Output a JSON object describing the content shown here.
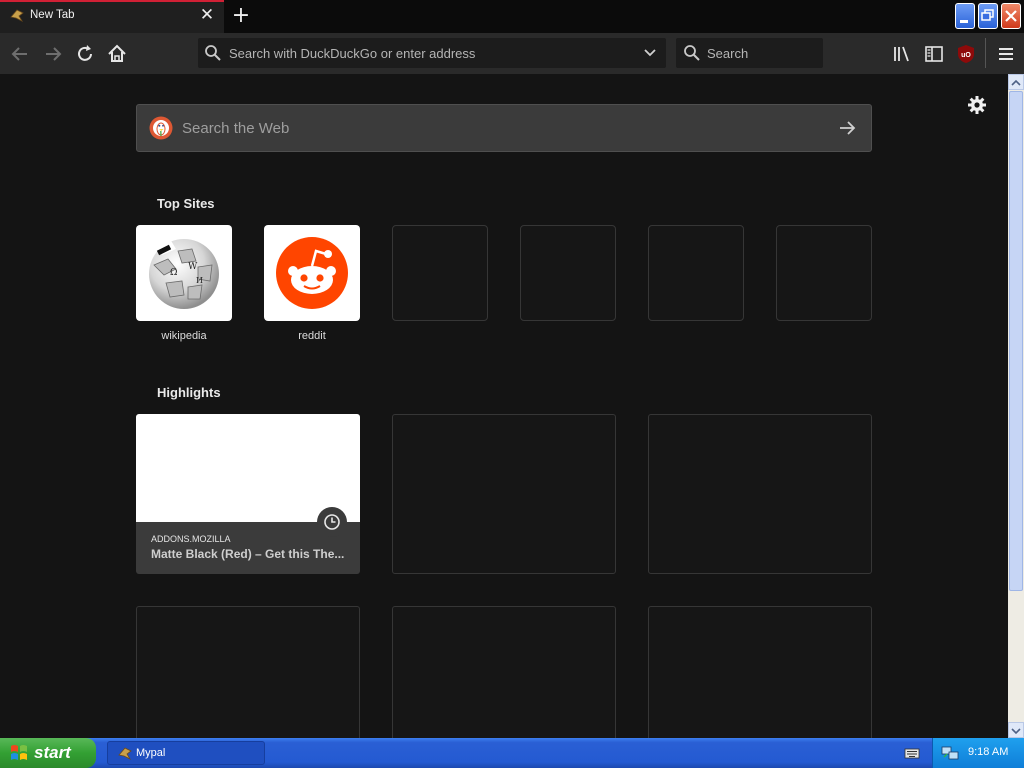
{
  "tab": {
    "title": "New Tab"
  },
  "navbar": {
    "url_placeholder": "Search with DuckDuckGo or enter address",
    "search_placeholder": "Search",
    "ublock_badge": "uO"
  },
  "newtab": {
    "websearch_placeholder": "Search the Web",
    "top_sites_title": "Top Sites",
    "top_sites": [
      {
        "label": "wikipedia"
      },
      {
        "label": "reddit"
      }
    ],
    "highlights_title": "Highlights",
    "highlights": [
      {
        "host": "ADDONS.MOZILLA",
        "title": "Matte Black (Red) – Get this The..."
      }
    ]
  },
  "taskbar": {
    "start_label": "start",
    "window_label": "Mypal",
    "clock": "9:18 AM"
  },
  "colors": {
    "accent_tab": "#d12035",
    "background": "#141414",
    "reddit": "#ff4500"
  }
}
